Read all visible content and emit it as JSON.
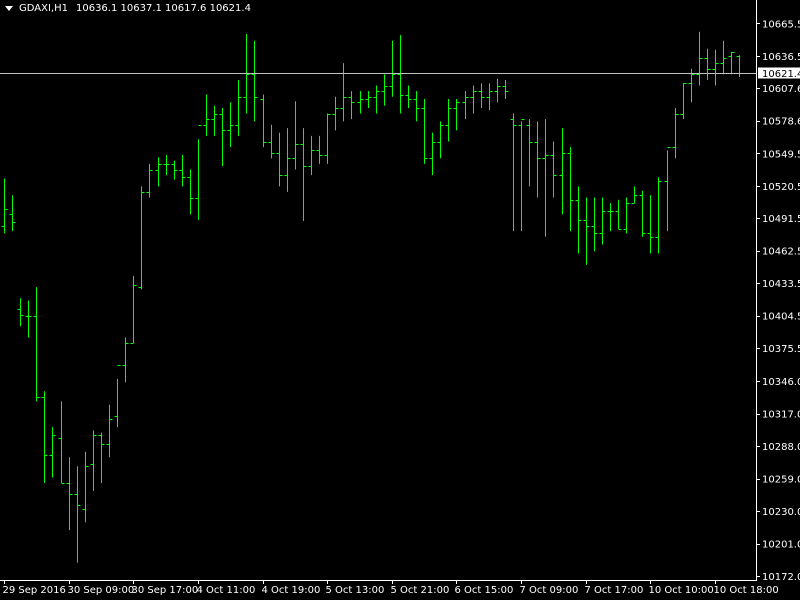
{
  "header": {
    "symbol": "GDAXI,H1",
    "ohlc": "10636.1 10637.1 10617.6 10621.4"
  },
  "current_price": {
    "label": "10621.4",
    "value": 10621.4
  },
  "colors": {
    "background": "#000000",
    "bar": "#00ff00",
    "axis": "#ffffff",
    "price_line": "#c0c0c0"
  },
  "chart_data": {
    "type": "ohlc",
    "title": "",
    "xlabel": "",
    "ylabel": "",
    "ylim": [
      10172.0,
      10673.0
    ],
    "grid": false,
    "y_ticks": [
      "10665.5",
      "10636.5",
      "10607.6",
      "10578.6",
      "10549.5",
      "10520.5",
      "10491.5",
      "10462.5",
      "10433.5",
      "10404.5",
      "10375.5",
      "10346.0",
      "10317.0",
      "10288.0",
      "10259.0",
      "10230.0",
      "10201.0",
      "10172.0"
    ],
    "x_ticks": [
      {
        "index": 0,
        "label": "29 Sep 2016"
      },
      {
        "index": 8,
        "label": "30 Sep 09:00"
      },
      {
        "index": 16,
        "label": "30 Sep 17:00"
      },
      {
        "index": 24,
        "label": "4 Oct 11:00"
      },
      {
        "index": 32,
        "label": "4 Oct 19:00"
      },
      {
        "index": 40,
        "label": "5 Oct 13:00"
      },
      {
        "index": 48,
        "label": "5 Oct 21:00"
      },
      {
        "index": 56,
        "label": "6 Oct 15:00"
      },
      {
        "index": 64,
        "label": "7 Oct 09:00"
      },
      {
        "index": 72,
        "label": "7 Oct 17:00"
      },
      {
        "index": 80,
        "label": "10 Oct 10:00"
      },
      {
        "index": 88,
        "label": "10 Oct 18:00"
      }
    ],
    "bars": [
      [
        10485,
        10527,
        10478,
        10500
      ],
      [
        10495,
        10512,
        10480,
        10488
      ],
      [
        10410,
        10420,
        10395,
        10405
      ],
      [
        10404,
        10418,
        10385,
        10404
      ],
      [
        10404,
        10430,
        10328,
        10332
      ],
      [
        10332,
        10337,
        10255,
        10280
      ],
      [
        10280,
        10305,
        10260,
        10298
      ],
      [
        10295,
        10328,
        10255,
        10255
      ],
      [
        10255,
        10278,
        10213,
        10245
      ],
      [
        10245,
        10270,
        10184,
        10235
      ],
      [
        10232,
        10283,
        10220,
        10270
      ],
      [
        10272,
        10302,
        10248,
        10298
      ],
      [
        10298,
        10300,
        10255,
        10290
      ],
      [
        10290,
        10325,
        10278,
        10312
      ],
      [
        10315,
        10348,
        10305,
        10360
      ],
      [
        10360,
        10385,
        10345,
        10380
      ],
      [
        10380,
        10440,
        10380,
        10432
      ],
      [
        10430,
        10520,
        10428,
        10515
      ],
      [
        10515,
        10540,
        10510,
        10535
      ],
      [
        10535,
        10546,
        10520,
        10540
      ],
      [
        10540,
        10548,
        10530,
        10540
      ],
      [
        10540,
        10543,
        10526,
        10535
      ],
      [
        10535,
        10548,
        10520,
        10528
      ],
      [
        10528,
        10535,
        10495,
        10510
      ],
      [
        10510,
        10562,
        10490,
        10575
      ],
      [
        10575,
        10602,
        10565,
        10580
      ],
      [
        10580,
        10592,
        10565,
        10585
      ],
      [
        10585,
        10590,
        10538,
        10570
      ],
      [
        10570,
        10595,
        10555,
        10575
      ],
      [
        10575,
        10615,
        10565,
        10600
      ],
      [
        10600,
        10656,
        10585,
        10620
      ],
      [
        10620,
        10650,
        10578,
        10600
      ],
      [
        10598,
        10602,
        10555,
        10560
      ],
      [
        10560,
        10575,
        10545,
        10550
      ],
      [
        10550,
        10568,
        10520,
        10530
      ],
      [
        10530,
        10572,
        10515,
        10545
      ],
      [
        10545,
        10596,
        10535,
        10558
      ],
      [
        10558,
        10572,
        10489,
        10538
      ],
      [
        10538,
        10565,
        10530,
        10552
      ],
      [
        10552,
        10565,
        10540,
        10548
      ],
      [
        10548,
        10585,
        10540,
        10585
      ],
      [
        10585,
        10600,
        10570,
        10590
      ],
      [
        10590,
        10630,
        10578,
        10600
      ],
      [
        10600,
        10605,
        10580,
        10595
      ],
      [
        10595,
        10605,
        10585,
        10598
      ],
      [
        10598,
        10605,
        10590,
        10600
      ],
      [
        10600,
        10610,
        10585,
        10605
      ],
      [
        10605,
        10620,
        10592,
        10610
      ],
      [
        10610,
        10650,
        10600,
        10620
      ],
      [
        10620,
        10655,
        10585,
        10602
      ],
      [
        10602,
        10610,
        10590,
        10598
      ],
      [
        10598,
        10605,
        10578,
        10590
      ],
      [
        10590,
        10598,
        10540,
        10545
      ],
      [
        10545,
        10568,
        10530,
        10560
      ],
      [
        10560,
        10578,
        10545,
        10575
      ],
      [
        10575,
        10598,
        10560,
        10590
      ],
      [
        10590,
        10598,
        10570,
        10595
      ],
      [
        10595,
        10605,
        10580,
        10600
      ],
      [
        10600,
        10610,
        10585,
        10605
      ],
      [
        10605,
        10612,
        10590,
        10600
      ],
      [
        10600,
        10612,
        10588,
        10605
      ],
      [
        10605,
        10616,
        10595,
        10610
      ],
      [
        10610,
        10615,
        10598,
        10605
      ],
      [
        10580,
        10585,
        10480,
        10575
      ],
      [
        10575,
        10578,
        10480,
        10580
      ],
      [
        10575,
        10580,
        10520,
        10560
      ],
      [
        10560,
        10578,
        10510,
        10545
      ],
      [
        10545,
        10580,
        10475,
        10548
      ],
      [
        10548,
        10560,
        10510,
        10530
      ],
      [
        10530,
        10572,
        10495,
        10550
      ],
      [
        10550,
        10555,
        10480,
        10508
      ],
      [
        10508,
        10520,
        10460,
        10490
      ],
      [
        10490,
        10510,
        10450,
        10485
      ],
      [
        10485,
        10510,
        10462,
        10478
      ],
      [
        10478,
        10510,
        10468,
        10498
      ],
      [
        10498,
        10505,
        10480,
        10498
      ],
      [
        10498,
        10508,
        10482,
        10482
      ],
      [
        10482,
        10510,
        10478,
        10505
      ],
      [
        10505,
        10520,
        10505,
        10512
      ],
      [
        10512,
        10516,
        10475,
        10478
      ],
      [
        10478,
        10512,
        10460,
        10475
      ],
      [
        10475,
        10528,
        10460,
        10525
      ],
      [
        10525,
        10552,
        10480,
        10555
      ],
      [
        10555,
        10590,
        10545,
        10585
      ],
      [
        10585,
        10612,
        10580,
        10612
      ],
      [
        10612,
        10625,
        10595,
        10620
      ],
      [
        10620,
        10658,
        10610,
        10635
      ],
      [
        10635,
        10643,
        10615,
        10625
      ],
      [
        10625,
        10642,
        10610,
        10630
      ],
      [
        10630,
        10650,
        10620,
        10635
      ],
      [
        10636,
        10640,
        10620,
        10640
      ],
      [
        10636.1,
        10637.1,
        10617.6,
        10621.4
      ]
    ]
  }
}
